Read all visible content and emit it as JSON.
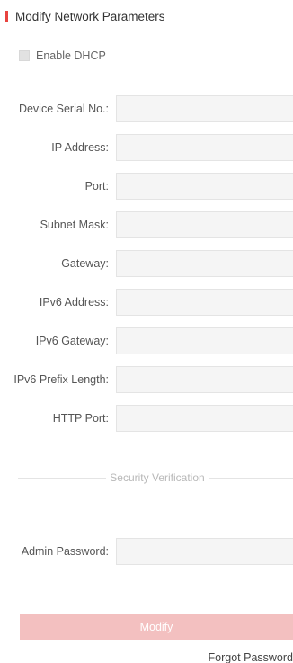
{
  "title": "Modify Network Parameters",
  "dhcp": {
    "label": "Enable DHCP",
    "checked": false
  },
  "fields": [
    {
      "label": "Device Serial No.:",
      "value": ""
    },
    {
      "label": "IP Address:",
      "value": ""
    },
    {
      "label": "Port:",
      "value": ""
    },
    {
      "label": "Subnet Mask:",
      "value": ""
    },
    {
      "label": "Gateway:",
      "value": ""
    },
    {
      "label": "IPv6 Address:",
      "value": ""
    },
    {
      "label": "IPv6 Gateway:",
      "value": ""
    },
    {
      "label": "IPv6 Prefix Length:",
      "value": ""
    },
    {
      "label": "HTTP Port:",
      "value": ""
    }
  ],
  "security": {
    "divider_text": "Security Verification",
    "password_label": "Admin Password:",
    "password_value": ""
  },
  "actions": {
    "modify_label": "Modify",
    "forgot_label": "Forgot Password"
  },
  "colors": {
    "accent": "#e8433f",
    "button_disabled": "#f3c0c0"
  }
}
